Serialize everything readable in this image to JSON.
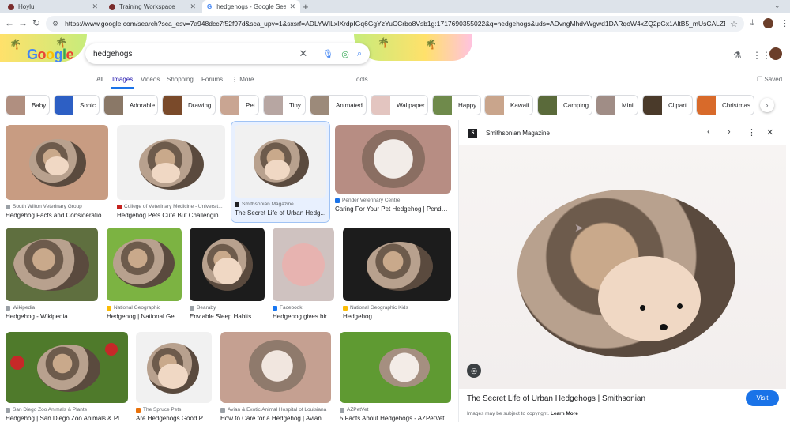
{
  "browser": {
    "tabs": [
      {
        "title": "Hoylu",
        "active": false
      },
      {
        "title": "Training Workspace",
        "active": false
      },
      {
        "title": "hedgehogs - Google Search",
        "active": true
      }
    ],
    "url": "https://www.google.com/search?sca_esv=7a948dcc7f52f97d&sca_upv=1&sxsrf=ADLYWILxIXrdpIGq6GgYzYuCCrbo8Vsb1g:1717690355022&q=hedgehogs&uds=ADvngMhdvWgwd1DARqoW4xZQ2pGx1AltB5_mUsCALZBsdVe5jM4ZGpaw1hp..."
  },
  "google": {
    "logo": [
      "G",
      "o",
      "o",
      "g",
      "l",
      "e"
    ],
    "query": "hedgehogs"
  },
  "searchtabs": {
    "all": "All",
    "images": "Images",
    "videos": "Videos",
    "shopping": "Shopping",
    "forums": "Forums",
    "more": "⋮ More",
    "tools": "Tools",
    "saved": "Saved"
  },
  "chips": [
    {
      "label": "Baby",
      "color": "#b08f80"
    },
    {
      "label": "Sonic",
      "color": "#2d5fc4"
    },
    {
      "label": "Adorable",
      "color": "#8a7867"
    },
    {
      "label": "Drawing",
      "color": "#7a4a2a"
    },
    {
      "label": "Pet",
      "color": "#c9a592"
    },
    {
      "label": "Tiny",
      "color": "#b7a6a2"
    },
    {
      "label": "Animated",
      "color": "#9c8a7a"
    },
    {
      "label": "Wallpaper",
      "color": "#e3c5c0"
    },
    {
      "label": "Happy",
      "color": "#6f8a4b"
    },
    {
      "label": "Kawaii",
      "color": "#c9a58c"
    },
    {
      "label": "Camping",
      "color": "#5a6a3a"
    },
    {
      "label": "Mini",
      "color": "#a08d86"
    },
    {
      "label": "Clipart",
      "color": "#4a3a2a"
    },
    {
      "label": "Christmas",
      "color": "#d86a2a"
    }
  ],
  "results": [
    {
      "source": "South Wilton Veterinary Group",
      "title": "Hedgehog Facts and Consideratio..."
    },
    {
      "source": "College of Veterinary Medicine - Universit...",
      "title": "Hedgehog Pets Cute But Challenging ..."
    },
    {
      "source": "Smithsonian Magazine",
      "title": "The Secret Life of Urban Hedg..."
    },
    {
      "source": "Pender Veterinary Centre",
      "title": "Caring For Your Pet Hedgehog | Pender..."
    },
    {
      "source": "Wikipedia",
      "title": "Hedgehog - Wikipedia"
    },
    {
      "source": "National Geographic",
      "title": "Hedgehog | National Ge..."
    },
    {
      "source": "Bearaby",
      "title": "Enviable Sleep Habits"
    },
    {
      "source": "Facebook",
      "title": "Hedgehog gives bir..."
    },
    {
      "source": "National Geographic Kids",
      "title": "Hedgehog"
    },
    {
      "source": "San Diego Zoo Animals & Plants",
      "title": "Hedgehog | San Diego Zoo Animals & Pla..."
    },
    {
      "source": "The Spruce Pets",
      "title": "Are Hedgehogs Good P..."
    },
    {
      "source": "Avian & Exotic Animal Hospital of Louisiana",
      "title": "How to Care for a Hedgehog | Avian ..."
    },
    {
      "source": "AZPetVet",
      "title": "5 Facts About Hedgehogs - AZPetVet"
    }
  ],
  "preview": {
    "logo_letter": "S",
    "site": "Smithsonian Magazine",
    "title": "The Secret Life of Urban Hedgehogs | Smithsonian",
    "visit": "Visit",
    "copyright": "Images may be subject to copyright.",
    "learn_more": "Learn More"
  },
  "colors": {
    "accent": "#1a73e8",
    "link": "#1a0dab"
  }
}
